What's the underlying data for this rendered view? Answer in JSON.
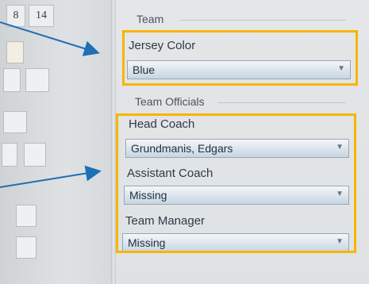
{
  "left_panel": {
    "numbers": [
      "8",
      "14"
    ]
  },
  "team_section": {
    "title": "Team",
    "jersey_color": {
      "label": "Jersey Color",
      "value": "Blue"
    }
  },
  "team_officials_section": {
    "title": "Team Officials",
    "head_coach": {
      "label": "Head Coach",
      "value": "Grundmanis, Edgars"
    },
    "assistant_coach": {
      "label": "Assistant Coach",
      "value": "Missing"
    },
    "team_manager": {
      "label": "Team Manager",
      "value": "Missing"
    }
  },
  "annotations": {
    "highlight_color": "#f7b500",
    "arrow_color": "#1f6fb5"
  }
}
